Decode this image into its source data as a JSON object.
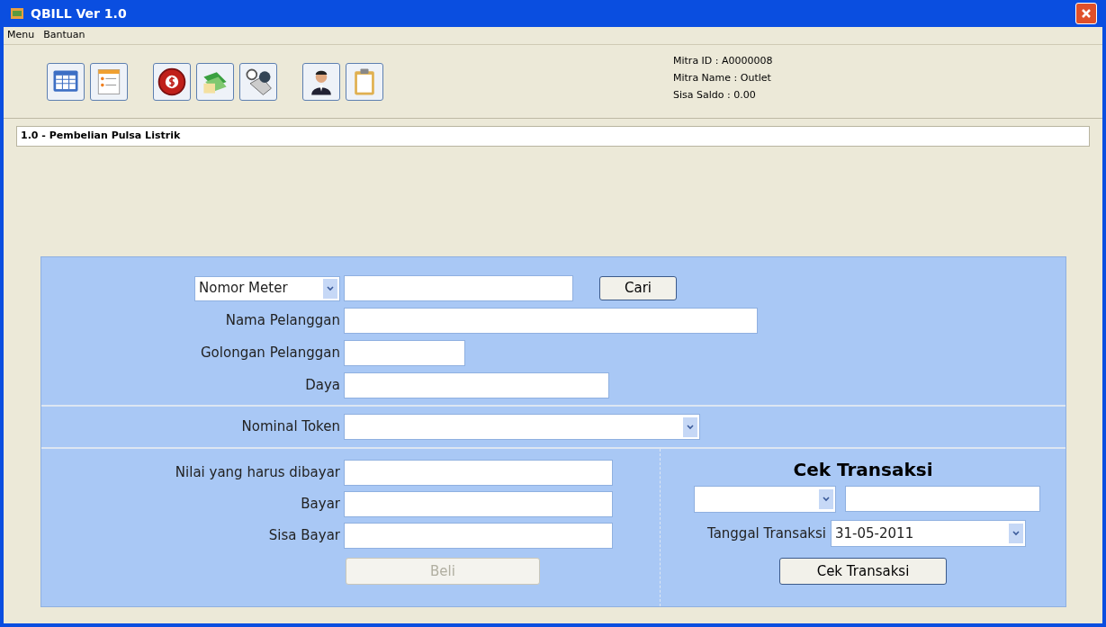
{
  "window": {
    "title": "QBILL Ver 1.0"
  },
  "menu": [
    {
      "label": "Menu"
    },
    {
      "label": "Bantuan"
    }
  ],
  "mitra": {
    "id": "Mitra ID : A0000008",
    "name": "Mitra Name : Outlet",
    "saldo": "Sisa Saldo : 0.00"
  },
  "section_title": "1.0 - Pembelian Pulsa Listrik",
  "search": {
    "type_select": "Nomor Meter",
    "button": "Cari"
  },
  "customer_fields": [
    {
      "label": "Nama Pelanggan"
    },
    {
      "label": "Golongan Pelanggan"
    },
    {
      "label": "Daya"
    }
  ],
  "nominal": {
    "label": "Nominal Token"
  },
  "payment_fields": [
    {
      "label": "Nilai yang harus dibayar"
    },
    {
      "label": "Bayar"
    },
    {
      "label": "Sisa Bayar"
    }
  ],
  "buy_button": {
    "label": "Beli",
    "disabled": true
  },
  "cek": {
    "title": "Cek Transaksi",
    "date_label": "Tanggal Transaksi",
    "date": "31-05-2011",
    "button": "Cek Transaksi"
  }
}
